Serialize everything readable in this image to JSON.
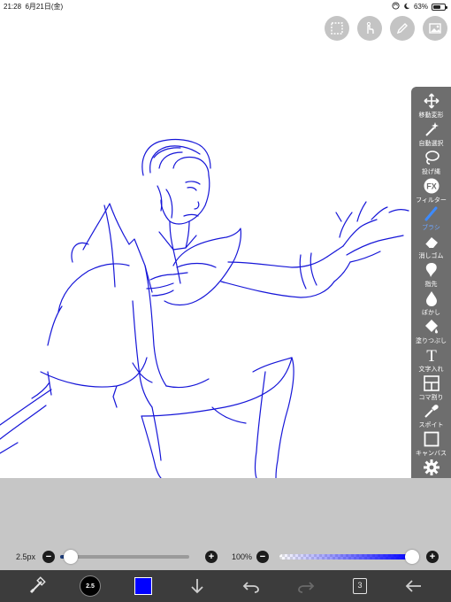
{
  "status_bar": {
    "time": "21:28",
    "date": "6月21日(金)",
    "battery": "63%",
    "battery_level": 0.63
  },
  "toolbar": {
    "items": [
      {
        "label": "移動変形",
        "icon": "move-arrows-icon"
      },
      {
        "label": "自動選択",
        "icon": "magic-wand-icon"
      },
      {
        "label": "投げ縄",
        "icon": "lasso-icon"
      },
      {
        "label": "フィルター",
        "icon": "fx-icon"
      },
      {
        "label": "ブラシ",
        "icon": "brush-icon",
        "active": true
      },
      {
        "label": "消しゴム",
        "icon": "eraser-icon"
      },
      {
        "label": "指先",
        "icon": "smudge-finger-icon"
      },
      {
        "label": "ぼかし",
        "icon": "blur-drop-icon"
      },
      {
        "label": "塗りつぶし",
        "icon": "bucket-fill-icon"
      },
      {
        "label": "文字入れ",
        "icon": "text-t-icon"
      },
      {
        "label": "コマ割り",
        "icon": "panel-frame-icon"
      },
      {
        "label": "スポイト",
        "icon": "eyedropper-icon"
      },
      {
        "label": "キャンバス",
        "icon": "canvas-square-icon"
      },
      {
        "label": "設定",
        "icon": "gear-icon"
      }
    ],
    "fx_text": "FX",
    "text_tool_glyph": "T"
  },
  "brush": {
    "size_label": "2.5px",
    "size_fraction": 0.08,
    "minus": "−",
    "plus": "+"
  },
  "opacity": {
    "label": "100%",
    "value_fraction": 1.0,
    "minus": "−",
    "plus": "+"
  },
  "bottom_bar": {
    "brush_size_text": "2.5",
    "color": "#0000ff",
    "layer_count": "3"
  },
  "colors": {
    "stroke": "#1616d8",
    "accent": "#3d8bff",
    "toolbar_bg": "#6e6e6e"
  }
}
